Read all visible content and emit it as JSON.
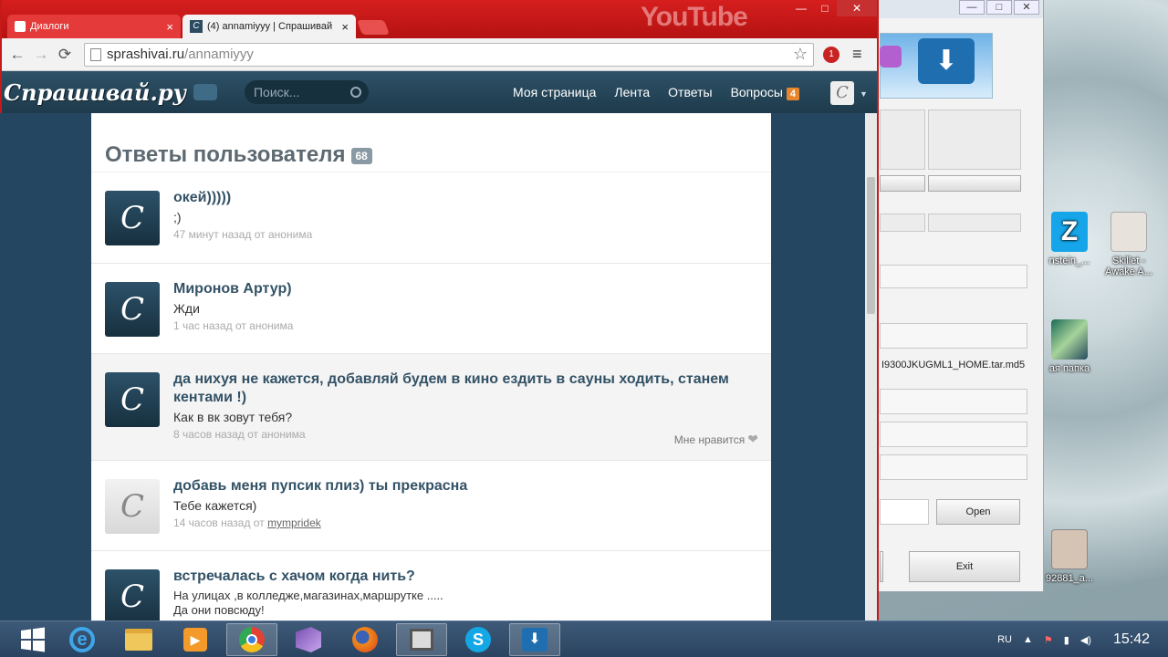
{
  "browser": {
    "tabs": [
      {
        "label": "Диалоги",
        "close": "×"
      },
      {
        "label": "(4) annamiyyy | Спрашивай",
        "close": "×"
      }
    ],
    "watermark": "YouTube",
    "window_controls": [
      "—",
      "□",
      "✕"
    ],
    "url_domain": "sprashivai.ru",
    "url_path": "/annamiyyy",
    "ext_badge": "1",
    "back": "←",
    "forward": "→",
    "reload": "⟳",
    "star": "☆",
    "menu": "≡"
  },
  "site": {
    "logo": "Спрашивай.ру",
    "search_placeholder": "Поиск...",
    "nav": {
      "my_page": "Моя страница",
      "feed": "Лента",
      "answers": "Ответы",
      "questions": "Вопросы",
      "questions_badge": "4"
    },
    "avatar_glyph": "C"
  },
  "main": {
    "title": "Ответы пользователя",
    "count": "68",
    "items": [
      {
        "question": "окей)))))",
        "answer": ";)",
        "time": "47 минут назад от анонима"
      },
      {
        "question": "Миронов Артур)",
        "answer": "Жди",
        "time": "1 час назад от анонима"
      },
      {
        "question": "да нихуя не кажется, добавляй будем в кино ездить в сауны ходить, станем кентами !)",
        "answer": "Как в вк зовут тебя?",
        "time": "8 часов назад от анонима",
        "like": "Мне нравится"
      },
      {
        "question": "добавь меня пупсик плиз) ты прекрасна",
        "answer": "Тебе кажется)",
        "time_prefix": "14 часов назад от",
        "user": "mympridek"
      },
      {
        "question": "встречалась с хачом когда нить?",
        "answer_line1": "На улицах ,в колледже,магазинах,маршрутке .....",
        "answer_line2": "Да они повсюду!"
      }
    ]
  },
  "app_window": {
    "file_label": "I9300JKUGML1_HOME.tar.md5",
    "open_button": "Open",
    "exit_button": "Exit"
  },
  "desktop": {
    "icons": [
      {
        "label": "nstein_..."
      },
      {
        "label": "Skillet - Awake A..."
      },
      {
        "label": "ая папка"
      },
      {
        "label": "92881_a..."
      }
    ]
  },
  "taskbar": {
    "lang": "RU",
    "time": "15:42"
  }
}
